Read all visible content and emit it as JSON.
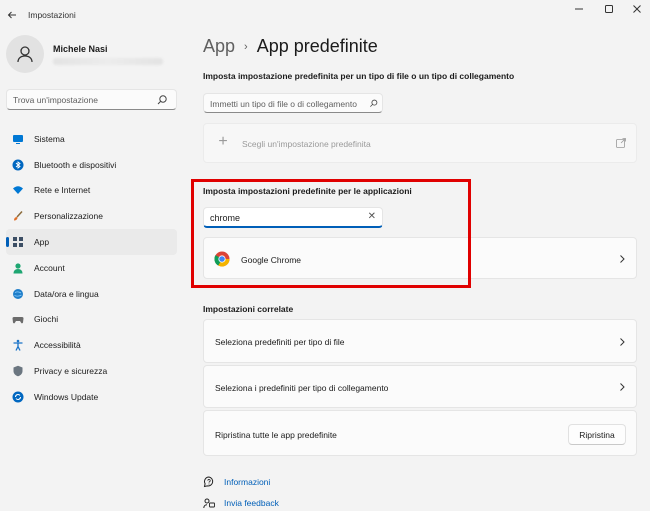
{
  "window": {
    "title": "Impostazioni",
    "back_icon": "back-arrow-icon",
    "controls": [
      "minimize-icon",
      "maximize-icon",
      "close-icon"
    ]
  },
  "profile": {
    "name": "Michele Nasi",
    "avatar_icon": "person-icon"
  },
  "sidebar": {
    "search_placeholder": "Trova un'impostazione",
    "items": [
      {
        "label": "Sistema",
        "icon": "monitor-icon",
        "color": "#0078d4"
      },
      {
        "label": "Bluetooth e dispositivi",
        "icon": "bluetooth-icon",
        "color": "#0067c0"
      },
      {
        "label": "Rete e Internet",
        "icon": "wifi-icon",
        "color": "#0078d4"
      },
      {
        "label": "Personalizzazione",
        "icon": "brush-icon",
        "color": "#d4792a"
      },
      {
        "label": "App",
        "icon": "apps-icon",
        "color": "#3c4e64",
        "active": true
      },
      {
        "label": "Account",
        "icon": "account-icon",
        "color": "#1ea672"
      },
      {
        "label": "Data/ora e lingua",
        "icon": "globe-clock-icon",
        "color": "#1f7ec9"
      },
      {
        "label": "Giochi",
        "icon": "gamepad-icon",
        "color": "#6b6b6b"
      },
      {
        "label": "Accessibilità",
        "icon": "accessibility-icon",
        "color": "#1a73c8"
      },
      {
        "label": "Privacy e sicurezza",
        "icon": "shield-icon",
        "color": "#6b7680"
      },
      {
        "label": "Windows Update",
        "icon": "update-icon",
        "color": "#0067c0"
      }
    ]
  },
  "breadcrumb": {
    "parent": "App",
    "separator": "›",
    "current": "App predefinite"
  },
  "file_type_section": {
    "label": "Imposta impostazione predefinita per un tipo di file o un tipo di collegamento",
    "input_placeholder": "Immetti un tipo di file o di collegamento",
    "choose_default_label": "Scegli un'impostazione predefinita"
  },
  "apps_section": {
    "label": "Imposta impostazioni predefinite per le applicazioni",
    "search_value": "chrome",
    "result_label": "Google Chrome"
  },
  "related": {
    "label": "Impostazioni correlate",
    "items": [
      "Seleziona predefiniti per tipo di file",
      "Seleziona i predefiniti per tipo di collegamento"
    ],
    "reset_label": "Ripristina tutte le app predefinite",
    "reset_button": "Ripristina"
  },
  "links": {
    "info": "Informazioni",
    "feedback": "Invia feedback"
  },
  "colors": {
    "accent": "#005fb8",
    "highlight": "#e00000"
  }
}
